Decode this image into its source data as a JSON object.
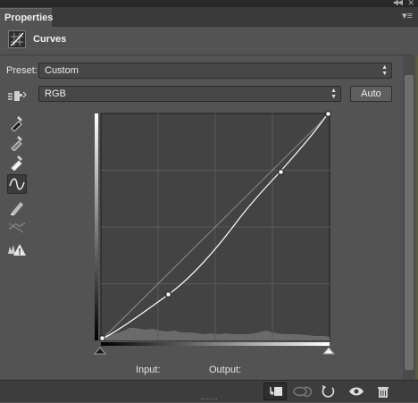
{
  "panel": {
    "tab_label": "Properties",
    "title": "Curves"
  },
  "preset": {
    "label": "Preset:",
    "value": "Custom"
  },
  "channel": {
    "value": "RGB",
    "auto_label": "Auto"
  },
  "readout": {
    "input_label": "Input:",
    "output_label": "Output:"
  },
  "icons": {
    "top": [
      "collapse-icon",
      "close-icon",
      "panel-menu-icon"
    ],
    "header": "curves-adjustment-icon",
    "tools": [
      "on-image-adjust-icon",
      "sample-black-point-icon",
      "sample-gray-point-icon",
      "sample-white-point-icon",
      "edit-points-curve-icon",
      "draw-pencil-icon",
      "smooth-curve-icon",
      "clipping-warning-icon"
    ],
    "bottom": [
      "clip-to-layer-icon",
      "view-previous-state-icon",
      "reset-icon",
      "visibility-eye-icon",
      "delete-icon"
    ]
  },
  "colors": {
    "panel_bg": "#535353",
    "graph_bg": "#434343",
    "curve": "#ffffff"
  }
}
